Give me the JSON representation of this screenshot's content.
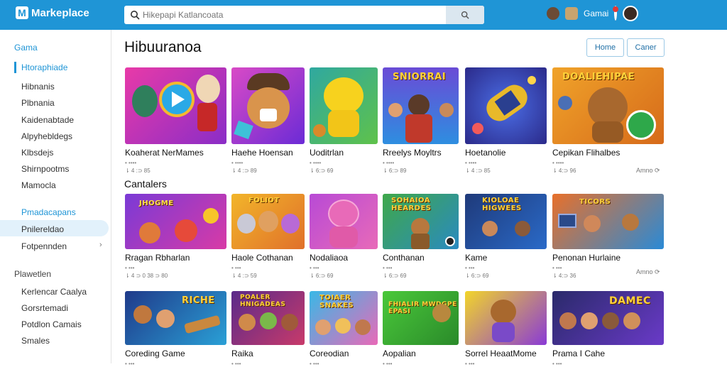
{
  "app": {
    "name": "Markeplace",
    "logo_letter": "M"
  },
  "search": {
    "placeholder": "Hikepapi Katlancoata"
  },
  "topbar": {
    "user_label": "Gamai"
  },
  "sidebar": {
    "sections": [
      {
        "title": "Gama",
        "items": [
          {
            "label": "Htoraphiade",
            "active": true
          },
          {
            "label": "Hibnanis"
          },
          {
            "label": "Plbnania"
          },
          {
            "label": "Kaidenabtade"
          },
          {
            "label": "Alpyhebldegs"
          },
          {
            "label": "Klbsdejs"
          },
          {
            "label": "Shirnpootms"
          },
          {
            "label": "Mamocla"
          }
        ]
      },
      {
        "title": "Pmadacapans",
        "items": [
          {
            "label": "Pnilereldao",
            "selected": true
          },
          {
            "label": "Fotpennden",
            "has_chevron": true
          }
        ]
      },
      {
        "title": "Plawetlen",
        "items": [
          {
            "label": "Kerlencar Caalya"
          },
          {
            "label": "Gorsrtemadi"
          },
          {
            "label": "Potdlon Camais"
          },
          {
            "label": "Smales"
          }
        ]
      }
    ]
  },
  "main": {
    "title": "Hibuuranoa",
    "buttons": {
      "home": "Home",
      "other": "Caner"
    },
    "section2_title": "Cantalers",
    "more_label": "Amno ⟳",
    "rows": [
      [
        {
          "title": "Koaherat NerMames",
          "sub1": "• ••••",
          "sub2": "⇂ 4 :⊃ 85"
        },
        {
          "title": "Haehe Hoensan",
          "sub1": "• ••••",
          "sub2": "⇂ 4 :⊃ 89"
        },
        {
          "title": "Uoditrlan",
          "sub1": "• ••••",
          "sub2": "⇂ 6:⊃ 69"
        },
        {
          "title": "Rreelys Moyltrs",
          "sub1": "• ••••",
          "sub2": "⇂ 6:⊃ 89"
        },
        {
          "title": "Hoetanolie",
          "sub1": "• ••••",
          "sub2": "⇂ 4 :⊃ 85"
        },
        {
          "title": "Cepikan Flihalbes",
          "sub1": "• ••••",
          "sub2": "⇂ 4:⊃ 96"
        }
      ],
      [
        {
          "title": "Rragan Rbharlan",
          "sub1": "• •••",
          "sub2": "⇂ 4 ⊃ 0 38 ⊃ 80"
        },
        {
          "title": "Haole Cothanan",
          "sub1": "• •••",
          "sub2": "⇂ 4 :⊃ 59"
        },
        {
          "title": "Nodaliaoa",
          "sub1": "• •••",
          "sub2": "⇂ 6:⊃ 69"
        },
        {
          "title": "Conthanan",
          "sub1": "• •••",
          "sub2": "⇂ 6:⊃ 69"
        },
        {
          "title": "Kame",
          "sub1": "• •••",
          "sub2": "⇂ 6:⊃ 69"
        },
        {
          "title": "Penonan Hurlaine",
          "sub1": "• •••",
          "sub2": "⇂ 4:⊃ 36"
        }
      ],
      [
        {
          "title": "Coreding Game",
          "sub1": "• •••"
        },
        {
          "title": "Raika",
          "sub1": "• •••"
        },
        {
          "title": "Coreodian",
          "sub1": "• •••"
        },
        {
          "title": "Aopalian",
          "sub1": "• •••"
        },
        {
          "title": "Sorrel HeaatMome",
          "sub1": "• •••"
        },
        {
          "title": "Prama I Cahe",
          "sub1": "• •••"
        }
      ]
    ],
    "thumb_texts": {
      "r1c4": "SNIORRAI",
      "r1c6": "DOALIEHIPAE",
      "r2c1": "JHOGME",
      "r2c2": "FOLIOT",
      "r2c4": "SOHAIOA HEARDES",
      "r2c5": "KIOLOAE HIGWEES",
      "r2c6": "TICORS",
      "r3c1": "RICHE",
      "r3c2": "POALER HNIGADEAS",
      "r3c3": "TOIAER SNAKES",
      "r3c4": "FHIALIR MWDGPE EPASI",
      "r3c6": "DAMEC"
    }
  }
}
